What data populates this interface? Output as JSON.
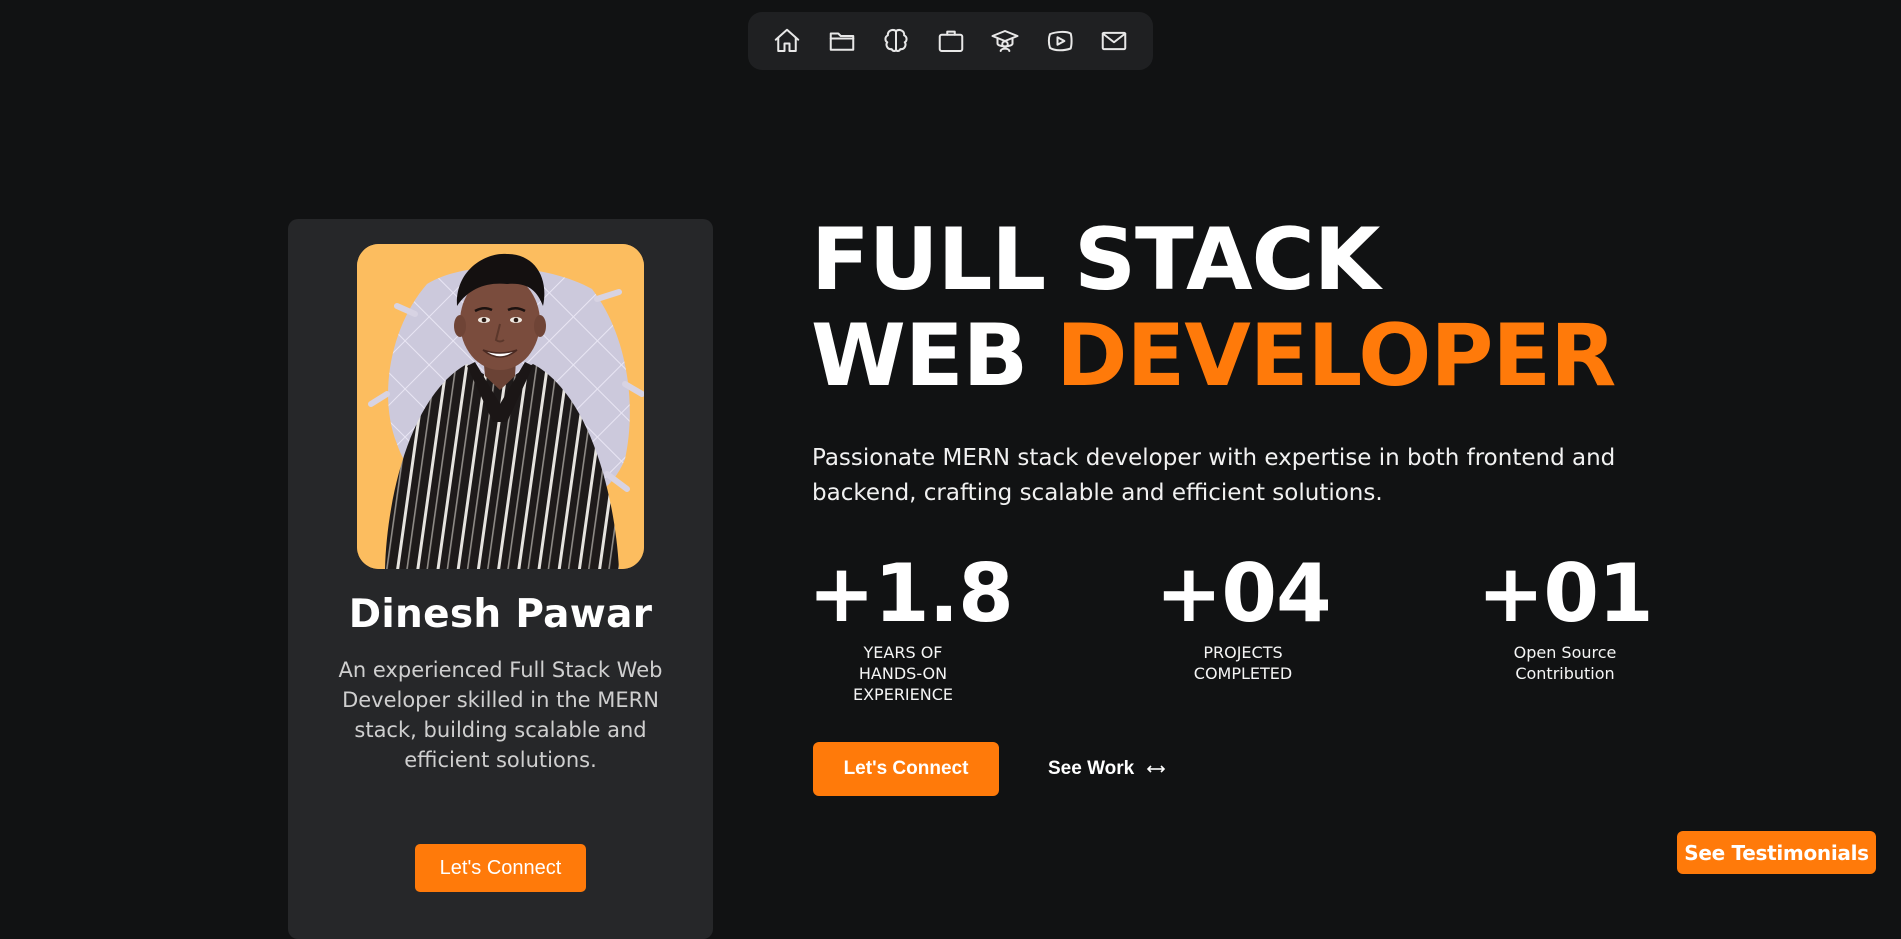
{
  "nav": {
    "items": [
      {
        "icon": "home-icon"
      },
      {
        "icon": "folder-icon"
      },
      {
        "icon": "brain-icon"
      },
      {
        "icon": "briefcase-icon"
      },
      {
        "icon": "graduation-cap-icon"
      },
      {
        "icon": "video-icon"
      },
      {
        "icon": "mail-icon"
      }
    ]
  },
  "profile": {
    "name": "Dinesh Pawar",
    "bio": "An experienced Full Stack Web Developer skilled in the MERN stack, building scalable and efficient solutions.",
    "connect_label": "Let's Connect"
  },
  "hero": {
    "title_line1": "FULL STACK",
    "title_line2_plain": "WEB ",
    "title_line2_accent": "DEVELOPER",
    "description": "Passionate MERN stack developer with expertise in both frontend and backend, crafting scalable and efficient solutions.",
    "stats": [
      {
        "value": "+1.8",
        "label_line1": "YEARS OF",
        "label_line2": "HANDS-ON EXPERIENCE"
      },
      {
        "value": "+04",
        "label_line1": "PROJECTS",
        "label_line2": "COMPLETED"
      },
      {
        "value": "+01",
        "label_line1": "Open Source",
        "label_line2": "Contribution"
      }
    ],
    "connect_label": "Let's Connect",
    "see_work_label": "See Work"
  },
  "testimonials_label": "See Testimonials",
  "colors": {
    "background": "#111213",
    "card": "#262729",
    "accent": "#ff7a0a",
    "nav": "#1f2022"
  }
}
